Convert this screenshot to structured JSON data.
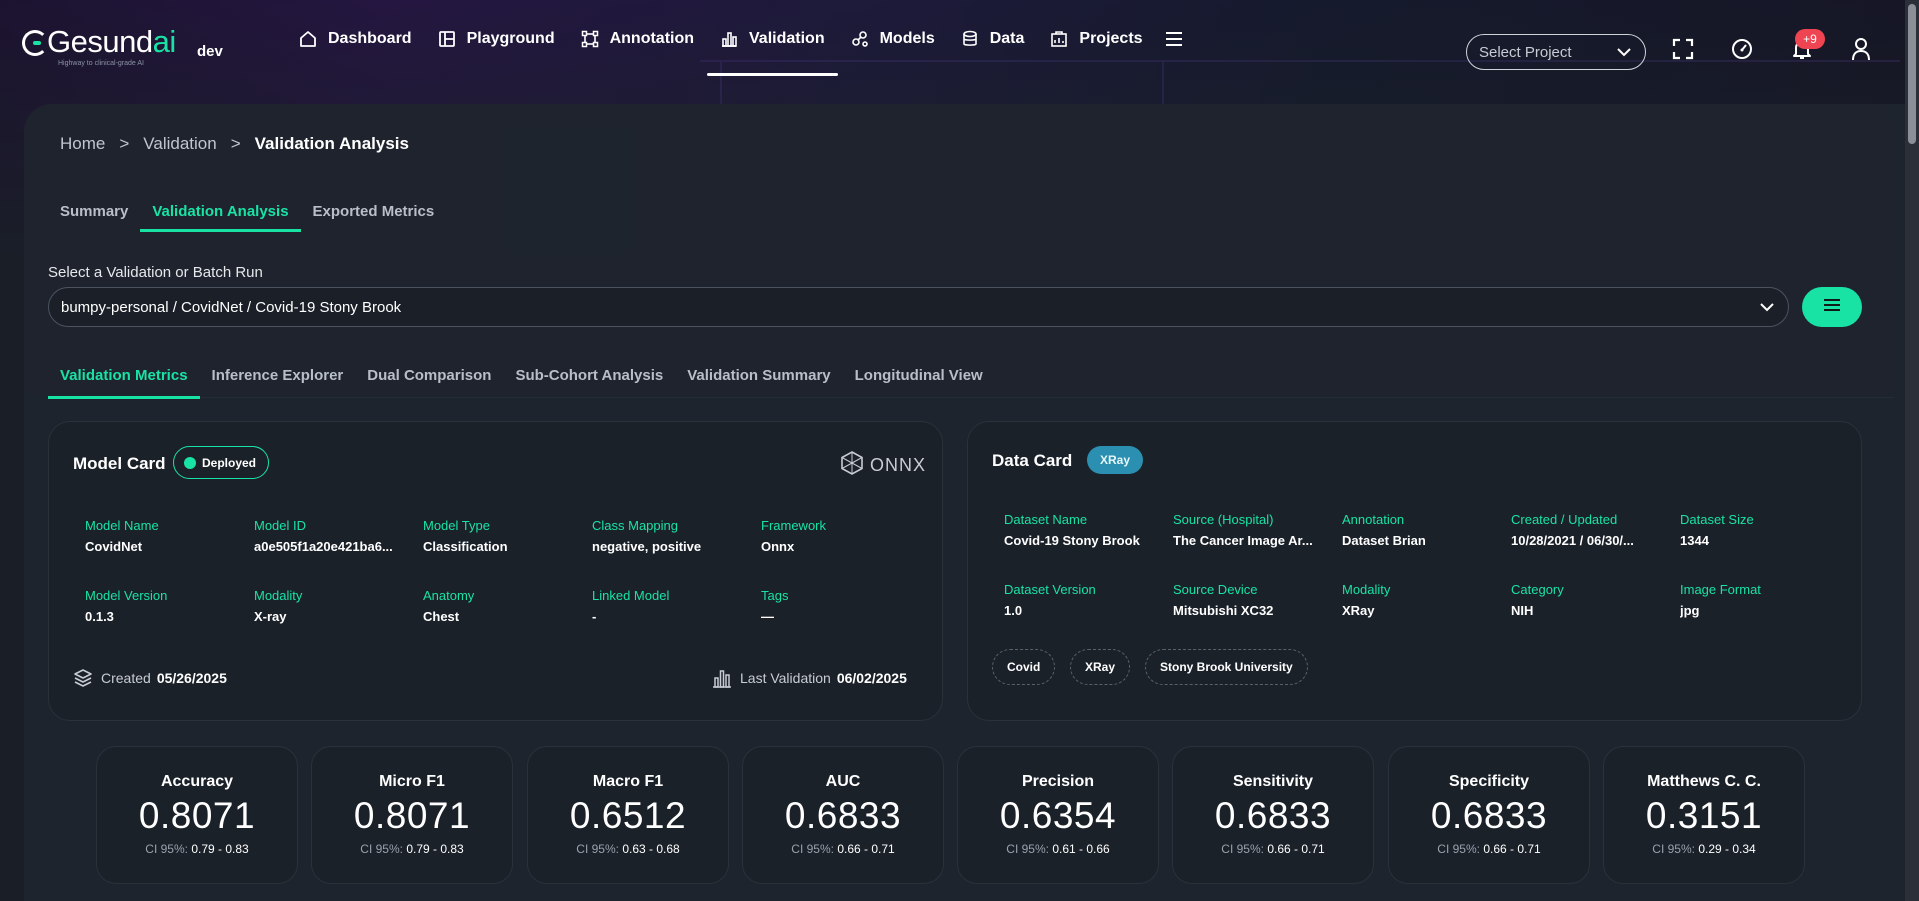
{
  "brand": {
    "logo_prefix": "Gesund",
    "logo_suffix": "ai",
    "tagline": "Highway to clinical-grade AI",
    "env": "dev"
  },
  "nav": {
    "items": [
      {
        "label": "Dashboard",
        "icon": "home-icon"
      },
      {
        "label": "Playground",
        "icon": "playground-icon"
      },
      {
        "label": "Annotation",
        "icon": "annotation-icon"
      },
      {
        "label": "Validation",
        "icon": "bar-chart-icon"
      },
      {
        "label": "Models",
        "icon": "models-icon"
      },
      {
        "label": "Data",
        "icon": "database-icon"
      },
      {
        "label": "Projects",
        "icon": "projects-icon"
      }
    ],
    "active": "Validation"
  },
  "header": {
    "project_select_placeholder": "Select Project",
    "notification_count": "+9"
  },
  "breadcrumb": {
    "home": "Home",
    "section": "Validation",
    "current": "Validation Analysis",
    "separator": ">"
  },
  "page_tabs": [
    "Summary",
    "Validation Analysis",
    "Exported Metrics"
  ],
  "run_selector": {
    "label": "Select a Validation or Batch Run",
    "value": "bumpy-personal / CovidNet / Covid-19 Stony Brook"
  },
  "analysis_tabs": [
    "Validation Metrics",
    "Inference Explorer",
    "Dual Comparison",
    "Sub-Cohort Analysis",
    "Validation Summary",
    "Longitudinal View"
  ],
  "model_card": {
    "title": "Model Card",
    "status": "Deployed",
    "framework_logo_text": "ONNX",
    "fields": [
      {
        "label": "Model Name",
        "value": "CovidNet"
      },
      {
        "label": "Model ID",
        "value": "a0e505f1a20e421ba6..."
      },
      {
        "label": "Model Type",
        "value": "Classification"
      },
      {
        "label": "Class Mapping",
        "value": "negative, positive"
      },
      {
        "label": "Framework",
        "value": "Onnx"
      },
      {
        "label": "Model Version",
        "value": "0.1.3"
      },
      {
        "label": "Modality",
        "value": "X-ray"
      },
      {
        "label": "Anatomy",
        "value": "Chest"
      },
      {
        "label": "Linked Model",
        "value": "-"
      },
      {
        "label": "Tags",
        "value": "—"
      }
    ],
    "created_label": "Created",
    "created_value": "05/26/2025",
    "last_validation_label": "Last Validation",
    "last_validation_value": "06/02/2025"
  },
  "data_card": {
    "title": "Data Card",
    "badge": "XRay",
    "fields": [
      {
        "label": "Dataset Name",
        "value": "Covid-19 Stony Brook"
      },
      {
        "label": "Source (Hospital)",
        "value": "The Cancer Image Ar..."
      },
      {
        "label": "Annotation",
        "value": "Dataset Brian"
      },
      {
        "label": "Created / Updated",
        "value": "10/28/2021 / 06/30/..."
      },
      {
        "label": "Dataset Size",
        "value": "1344"
      },
      {
        "label": "Dataset Version",
        "value": "1.0"
      },
      {
        "label": "Source Device",
        "value": "Mitsubishi XC32"
      },
      {
        "label": "Modality",
        "value": "XRay"
      },
      {
        "label": "Category",
        "value": "NIH"
      },
      {
        "label": "Image Format",
        "value": "jpg"
      }
    ],
    "tags": [
      "Covid",
      "XRay",
      "Stony Brook University"
    ]
  },
  "metrics": [
    {
      "name": "Accuracy",
      "value": "0.8071",
      "ci_label": "CI 95%:",
      "ci": "0.79 - 0.83"
    },
    {
      "name": "Micro F1",
      "value": "0.8071",
      "ci_label": "CI 95%:",
      "ci": "0.79 - 0.83"
    },
    {
      "name": "Macro F1",
      "value": "0.6512",
      "ci_label": "CI 95%:",
      "ci": "0.63 - 0.68"
    },
    {
      "name": "AUC",
      "value": "0.6833",
      "ci_label": "CI 95%:",
      "ci": "0.66 - 0.71"
    },
    {
      "name": "Precision",
      "value": "0.6354",
      "ci_label": "CI 95%:",
      "ci": "0.61 - 0.66"
    },
    {
      "name": "Sensitivity",
      "value": "0.6833",
      "ci_label": "CI 95%:",
      "ci": "0.66 - 0.71"
    },
    {
      "name": "Specificity",
      "value": "0.6833",
      "ci_label": "CI 95%:",
      "ci": "0.66 - 0.71"
    },
    {
      "name": "Matthews C. C.",
      "value": "0.3151",
      "ci_label": "CI 95%:",
      "ci": "0.29 - 0.34"
    }
  ],
  "colors": {
    "accent": "#19e3a4",
    "badge_blue": "#2a8fb0",
    "notification": "#ef4451",
    "panel": "#1e242d"
  }
}
